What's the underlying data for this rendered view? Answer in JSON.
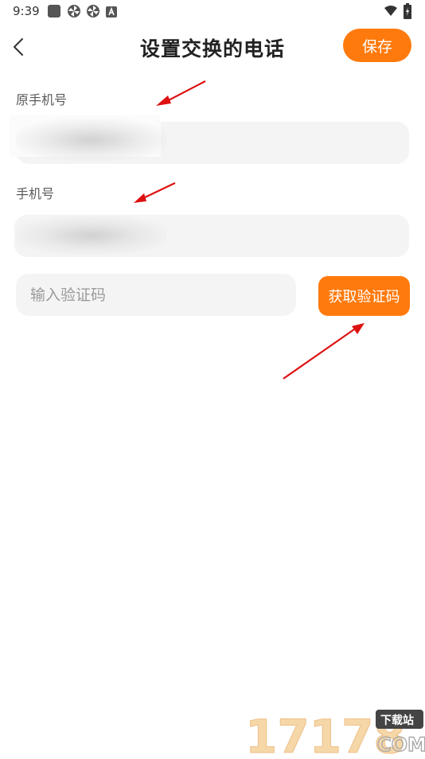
{
  "status_bar": {
    "time": "9:39",
    "icons": [
      "square-icon",
      "pinwheel-icon",
      "pinwheel-icon",
      "a-icon"
    ],
    "right_icons": [
      "wifi-icon",
      "battery-icon"
    ]
  },
  "header": {
    "title": "设置交换的电话",
    "save_label": "保存",
    "back_icon": "chevron-left-icon"
  },
  "form": {
    "original_phone_label": "原手机号",
    "phone_label": "手机号",
    "code_placeholder": "输入验证码",
    "get_code_label": "获取验证码"
  },
  "colors": {
    "accent": "#ff7a0d",
    "field_bg": "#f4f4f4",
    "annotation": "#dd1111"
  },
  "watermark": {
    "text": "17178",
    "badge": "下载站",
    "suffix": "COM"
  }
}
